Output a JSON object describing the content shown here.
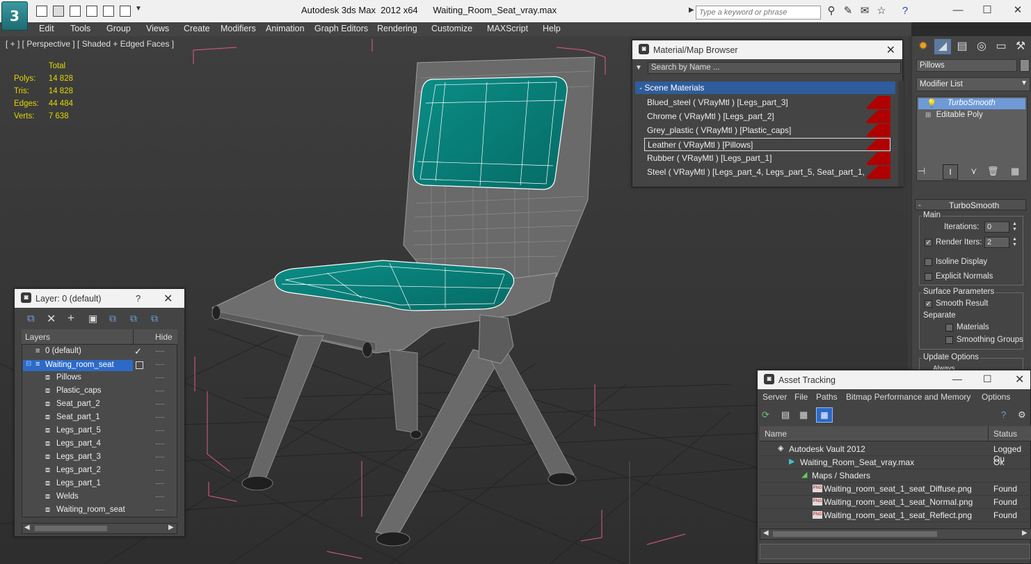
{
  "app": {
    "title": "Autodesk 3ds Max  2012 x64      Waiting_Room_Seat_vray.max",
    "search_placeholder": "Type a keyword or phrase"
  },
  "menu": [
    "Edit",
    "Tools",
    "Group",
    "Views",
    "Create",
    "Modifiers",
    "Animation",
    "Graph Editors",
    "Rendering",
    "Customize",
    "MAXScript",
    "Help"
  ],
  "viewport": {
    "label": "[ + ] [ Perspective ] [ Shaded + Edged Faces ]",
    "stats": {
      "header": "Total",
      "rows": [
        {
          "label": "Polys:",
          "value": "14 828"
        },
        {
          "label": "Tris:",
          "value": "14 828"
        },
        {
          "label": "Edges:",
          "value": "44 484"
        },
        {
          "label": "Verts:",
          "value": "7 638"
        }
      ]
    }
  },
  "command_panel": {
    "object_name": "Pillows",
    "modifier_list": "Modifier List",
    "stack": [
      "TurboSmooth",
      "Editable Poly"
    ],
    "rollout_title": "TurboSmooth",
    "main_label": "Main",
    "iterations_label": "Iterations:",
    "iterations_value": "0",
    "render_iters_label": "Render Iters:",
    "render_iters_value": "2",
    "isoline_label": "Isoline Display",
    "explicit_normals_label": "Explicit Normals",
    "surface_params_label": "Surface Parameters",
    "smooth_result_label": "Smooth Result",
    "separate_label": "Separate",
    "materials_label": "Materials",
    "smoothing_groups_label": "Smoothing Groups",
    "update_options_label": "Update Options",
    "always_label": "Always"
  },
  "material_browser": {
    "title": "Material/Map Browser",
    "search_placeholder": "Search by Name ...",
    "section": "Scene Materials",
    "materials": [
      "Blued_steel  ( VRayMtl ) [Legs_part_3]",
      "Chrome  ( VRayMtl ) [Legs_part_2]",
      "Grey_plastic  ( VRayMtl ) [Plastic_caps]",
      "Leather  ( VRayMtl ) [Pillows]",
      "Rubber  ( VRayMtl ) [Legs_part_1]",
      "Steel  ( VRayMtl ) [Legs_part_4, Legs_part_5, Seat_part_1, Seat_..."
    ]
  },
  "layer_window": {
    "title": "Layer: 0 (default)",
    "col_layers": "Layers",
    "col_hide": "Hide",
    "layers": [
      "0 (default)",
      "Waiting_room_seat"
    ],
    "objects": [
      "Pillows",
      "Plastic_caps",
      "Seat_part_2",
      "Seat_part_1",
      "Legs_part_5",
      "Legs_part_4",
      "Legs_part_3",
      "Legs_part_2",
      "Legs_part_1",
      "Welds",
      "Waiting_room_seat"
    ]
  },
  "asset_tracking": {
    "title": "Asset Tracking",
    "menu": [
      "Server",
      "File",
      "Paths",
      "Bitmap Performance and Memory",
      "Options"
    ],
    "col_name": "Name",
    "col_status": "Status",
    "rows": [
      {
        "name": "Autodesk Vault 2012",
        "status": "Logged Ou"
      },
      {
        "name": "Waiting_Room_Seat_vray.max",
        "status": "Ok"
      },
      {
        "name": "Maps / Shaders",
        "status": ""
      },
      {
        "name": "Waiting_room_seat_1_seat_Diffuse.png",
        "status": "Found"
      },
      {
        "name": "Waiting_room_seat_1_seat_Normal.png",
        "status": "Found"
      },
      {
        "name": "Waiting_room_seat_1_seat_Reflect.png",
        "status": "Found"
      }
    ]
  }
}
